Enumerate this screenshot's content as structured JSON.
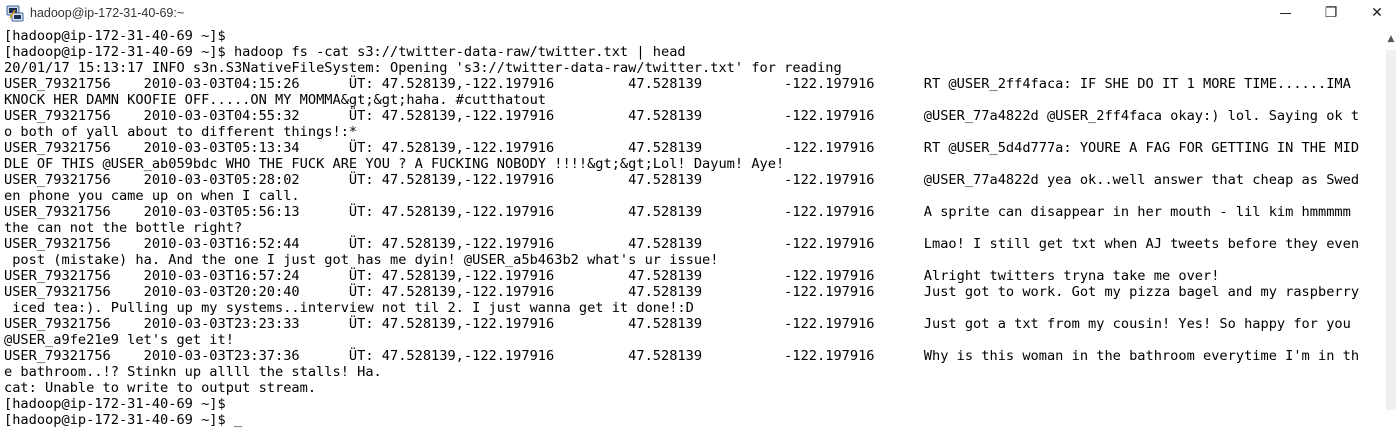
{
  "window": {
    "title": "hadoop@ip-172-31-40-69:~",
    "minimize_icon": "minimize-icon",
    "restore_label": "❐",
    "close_label": "✕"
  },
  "terminal": {
    "lines": [
      "[hadoop@ip-172-31-40-69 ~]$",
      "[hadoop@ip-172-31-40-69 ~]$ hadoop fs -cat s3://twitter-data-raw/twitter.txt | head",
      "20/01/17 15:13:17 INFO s3n.S3NativeFileSystem: Opening 's3://twitter-data-raw/twitter.txt' for reading",
      "USER_79321756    2010-03-03T04:15:26      ÜT: 47.528139,-122.197916         47.528139          -122.197916      RT @USER_2ff4faca: IF SHE DO IT 1 MORE TIME......IMA",
      "KNOCK HER DAMN KOOFIE OFF.....ON MY MOMMA&gt;&gt;haha. #cutthatout",
      "USER_79321756    2010-03-03T04:55:32      ÜT: 47.528139,-122.197916         47.528139          -122.197916      @USER_77a4822d @USER_2ff4faca okay:) lol. Saying ok t",
      "o both of yall about to different things!:*",
      "USER_79321756    2010-03-03T05:13:34      ÜT: 47.528139,-122.197916         47.528139          -122.197916      RT @USER_5d4d777a: YOURE A FAG FOR GETTING IN THE MID",
      "DLE OF THIS @USER_ab059bdc WHO THE FUCK ARE YOU ? A FUCKING NOBODY !!!!&gt;&gt;Lol! Dayum! Aye!",
      "USER_79321756    2010-03-03T05:28:02      ÜT: 47.528139,-122.197916         47.528139          -122.197916      @USER_77a4822d yea ok..well answer that cheap as Swed",
      "en phone you came up on when I call.",
      "USER_79321756    2010-03-03T05:56:13      ÜT: 47.528139,-122.197916         47.528139          -122.197916      A sprite can disappear in her mouth - lil kim hmmmmm",
      "the can not the bottle right?",
      "USER_79321756    2010-03-03T16:52:44      ÜT: 47.528139,-122.197916         47.528139          -122.197916      Lmao! I still get txt when AJ tweets before they even",
      " post (mistake) ha. And the one I just got has me dyin! @USER_a5b463b2 what's ur issue!",
      "USER_79321756    2010-03-03T16:57:24      ÜT: 47.528139,-122.197916         47.528139          -122.197916      Alright twitters tryna take me over!",
      "USER_79321756    2010-03-03T20:20:40      ÜT: 47.528139,-122.197916         47.528139          -122.197916      Just got to work. Got my pizza bagel and my raspberry",
      " iced tea:). Pulling up my systems..interview not til 2. I just wanna get it done!:D",
      "USER_79321756    2010-03-03T23:23:33      ÜT: 47.528139,-122.197916         47.528139          -122.197916      Just got a txt from my cousin! Yes! So happy for you",
      "@USER_a9fe21e9 let's get it!",
      "USER_79321756    2010-03-03T23:37:36      ÜT: 47.528139,-122.197916         47.528139          -122.197916      Why is this woman in the bathroom everytime I'm in th",
      "e bathroom..!? Stinkn up allll the stalls! Ha.",
      "cat: Unable to write to output stream.",
      "[hadoop@ip-172-31-40-69 ~]$",
      "[hadoop@ip-172-31-40-69 ~]$ "
    ],
    "cursor": "_"
  }
}
